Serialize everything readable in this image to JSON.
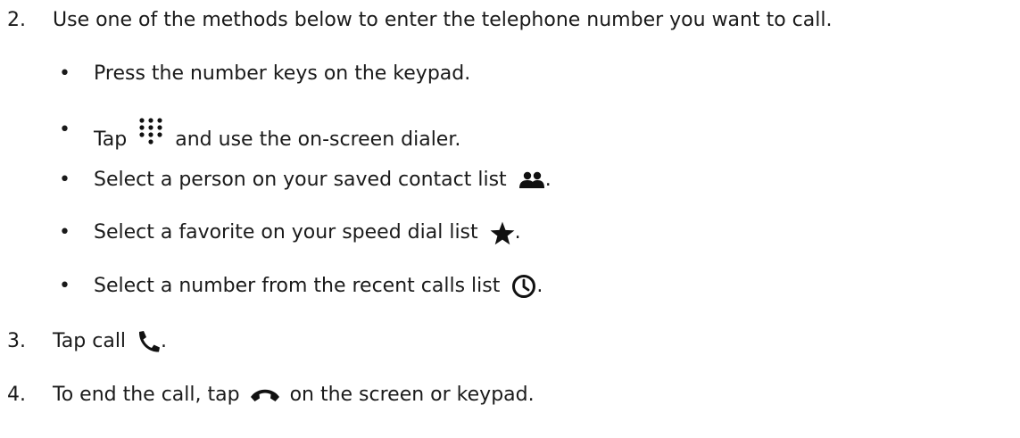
{
  "steps": [
    {
      "number": "2.",
      "text": "Use one of the methods below to enter the telephone number you want to call."
    },
    {
      "number": "3.",
      "text_before": "Tap call",
      "text_after": ".",
      "icon": "phone-icon"
    },
    {
      "number": "4.",
      "text_before": "To end the call, tap",
      "text_after": "on the screen or keypad.",
      "icon": "end-call-icon"
    }
  ],
  "bullets": [
    {
      "text": "Press the number keys on the keypad."
    },
    {
      "text_before": "Tap",
      "text_after": "and use the on-screen dialer.",
      "icon": "dialpad-icon"
    },
    {
      "text_before": "Select a person on your saved contact list",
      "text_after": ".",
      "icon": "contacts-icon"
    },
    {
      "text_before": "Select a favorite on your speed dial list",
      "text_after": ".",
      "icon": "star-icon"
    },
    {
      "text_before": "Select a number from the recent calls list",
      "text_after": ".",
      "icon": "clock-icon"
    }
  ],
  "bullet_char": "•"
}
